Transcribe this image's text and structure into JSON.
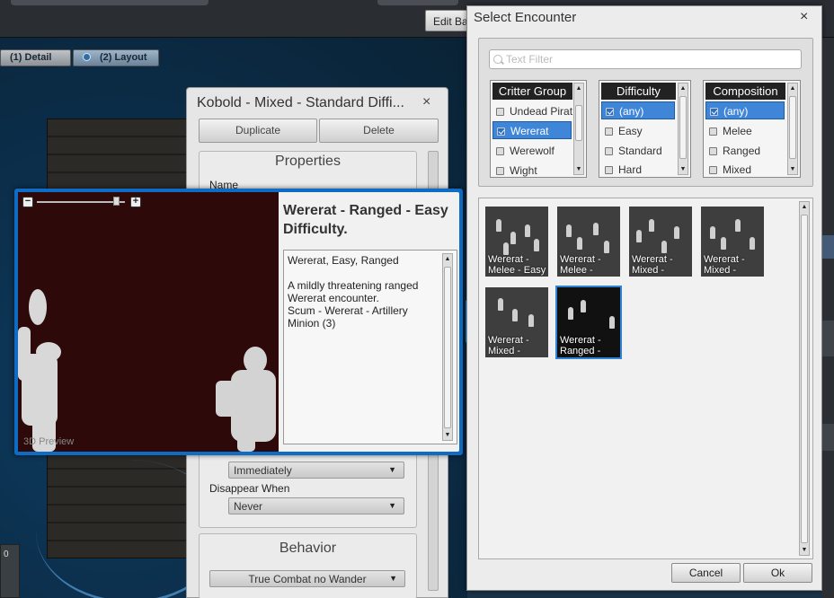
{
  "editor": {
    "toolbar_button": "Edit Ba",
    "tabs": [
      {
        "label": "(1) Detail"
      },
      {
        "label": "(2) Layout"
      }
    ],
    "left_stub": "0"
  },
  "properties_panel": {
    "title": "Kobold - Mixed - Standard Diffi...",
    "close": "×",
    "duplicate_label": "Duplicate",
    "delete_label": "Delete",
    "section_properties": "Properties",
    "name_label": "Name",
    "appear_value": "Immediately",
    "disappear_label": "Disappear When",
    "disappear_value": "Never",
    "section_behavior": "Behavior",
    "behavior_value": "True Combat no Wander"
  },
  "preview": {
    "zoom_minus": "−",
    "zoom_plus": "+",
    "zoom_level": 0.9,
    "stage_label": "3D Preview",
    "title": "Wererat - Ranged - Easy Difficulty.",
    "tags": "Wererat, Easy, Ranged",
    "description": "A mildly threatening ranged Wererat encounter.",
    "roster": "Scum - Wererat - Artillery Minion (3)"
  },
  "dialog": {
    "title": "Select Encounter",
    "close": "×",
    "filter_placeholder": "Text Filter",
    "lists": [
      {
        "header": "Critter Group",
        "items": [
          {
            "label": "Undead Pirat",
            "checked": false,
            "selected": false
          },
          {
            "label": "Wererat",
            "checked": true,
            "selected": true
          },
          {
            "label": "Werewolf",
            "checked": false,
            "selected": false
          },
          {
            "label": "Wight",
            "checked": false,
            "selected": false
          }
        ]
      },
      {
        "header": "Difficulty",
        "items": [
          {
            "label": "(any)",
            "checked": true,
            "selected": true
          },
          {
            "label": "Easy",
            "checked": false,
            "selected": false
          },
          {
            "label": "Standard",
            "checked": false,
            "selected": false
          },
          {
            "label": "Hard",
            "checked": false,
            "selected": false
          }
        ]
      },
      {
        "header": "Composition",
        "items": [
          {
            "label": "(any)",
            "checked": true,
            "selected": true
          },
          {
            "label": "Melee",
            "checked": false,
            "selected": false
          },
          {
            "label": "Ranged",
            "checked": false,
            "selected": false
          },
          {
            "label": "Mixed",
            "checked": false,
            "selected": false
          }
        ]
      }
    ],
    "results": [
      {
        "line1": "Wererat -",
        "line2": "Melee - Easy",
        "selected": false
      },
      {
        "line1": "Wererat -",
        "line2": "Melee -",
        "selected": false
      },
      {
        "line1": "Wererat -",
        "line2": "Mixed -",
        "selected": false
      },
      {
        "line1": "Wererat -",
        "line2": "Mixed -",
        "selected": false
      },
      {
        "line1": "Wererat -",
        "line2": "Mixed -",
        "selected": false
      },
      {
        "line1": "Wererat -",
        "line2": "Ranged -",
        "selected": true
      }
    ],
    "cancel_label": "Cancel",
    "ok_label": "Ok"
  },
  "colors": {
    "accent": "#3f86d9",
    "preview_border": "#0e6cc4",
    "stage_bg": "#2d0909"
  }
}
